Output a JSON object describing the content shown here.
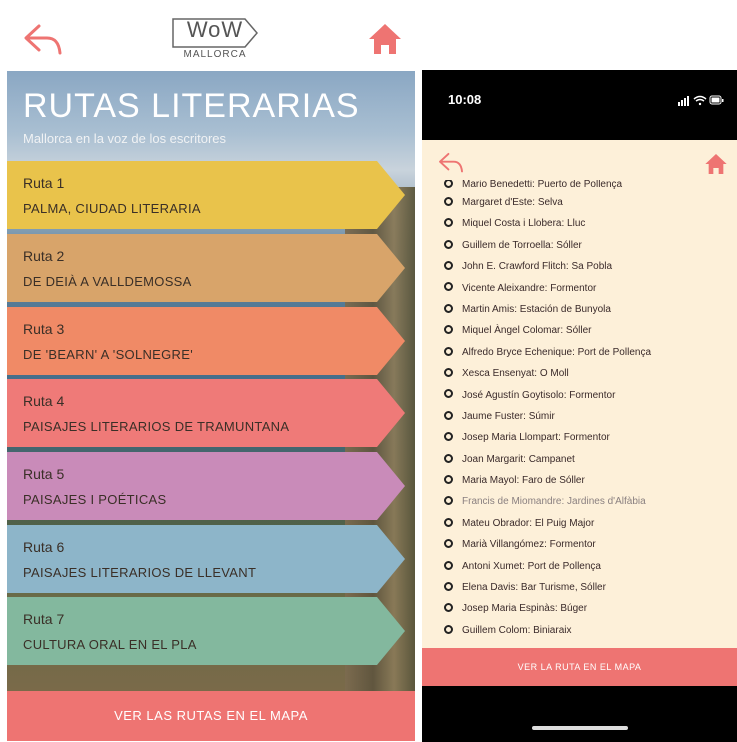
{
  "left": {
    "logo": {
      "name": "WoW",
      "sub": "MALLORCA"
    },
    "title": "RUTAS LITERARIAS",
    "subtitle": "Mallorca en la voz de los escritores",
    "routes": [
      {
        "num": "Ruta 1",
        "name": "PALMA, CIUDAD LITERARIA",
        "color": "#e9c34b"
      },
      {
        "num": "Ruta 2",
        "name": "DE DEIÀ A VALLDEMOSSA",
        "color": "#d8a46a"
      },
      {
        "num": "Ruta 3",
        "name": "DE 'BEARN' A 'SOLNEGRE'",
        "color": "#f08a66"
      },
      {
        "num": "Ruta 4",
        "name": "PAISAJES LITERARIOS DE TRAMUNTANA",
        "color": "#ef7a78"
      },
      {
        "num": "Ruta 5",
        "name": "PAISAJES I POÉTICAS",
        "color": "#c98bb9"
      },
      {
        "num": "Ruta 6",
        "name": "PAISAJES LITERARIOS DE LLEVANT",
        "color": "#8db5c9"
      },
      {
        "num": "Ruta 7",
        "name": "CULTURA ORAL EN EL PLA",
        "color": "#83b89e"
      }
    ],
    "cta": "VER LAS RUTAS EN EL MAPA"
  },
  "right": {
    "time": "10:08",
    "items": [
      "Mario Benedetti: Puerto de Pollença",
      "Margaret d'Este: Selva",
      "Miquel Costa i Llobera: Lluc",
      "Guillem de Torroella: Sóller",
      "John E. Crawford Flitch: Sa Pobla",
      "Vicente Aleixandre: Formentor",
      "Martin Amis: Estación de Bunyola",
      "Miquel Àngel Colomar: Sóller",
      "Alfredo Bryce Echenique: Port de Pollença",
      "Xesca Ensenyat: O Moll",
      "José Agustín Goytisolo: Formentor",
      "Jaume Fuster: Súmir",
      "Josep Maria Llompart: Formentor",
      "Joan Margarit: Campanet",
      "Maria Mayol: Faro de Sóller",
      "Francis de Miomandre: Jardines d'Alfàbia",
      "Mateu Obrador: El Puig Major",
      "Marià Villangómez: Formentor",
      "Antoni Xumet: Port de Pollença",
      "Elena Davis: Bar Turisme, Sóller",
      "Josep Maria Espinàs: Búger",
      "Guillem Colom: Biniaraix"
    ],
    "cta": "VER LA RUTA EN EL MAPA"
  },
  "colors": {
    "accent": "#ee7472",
    "panel": "#fdf0d9"
  }
}
